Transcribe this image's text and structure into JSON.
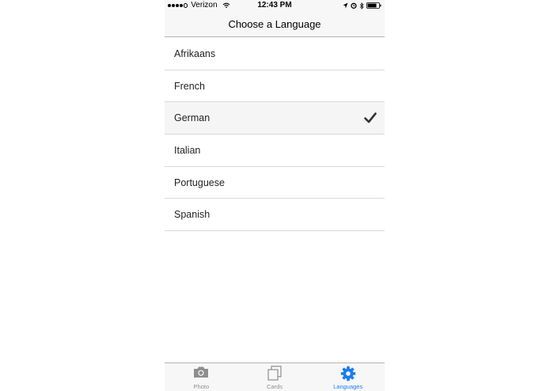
{
  "status_bar": {
    "carrier": "Verizon",
    "time": "12:43 PM"
  },
  "nav": {
    "title": "Choose a Language"
  },
  "languages": [
    {
      "label": "Afrikaans",
      "selected": false
    },
    {
      "label": "French",
      "selected": false
    },
    {
      "label": "German",
      "selected": true
    },
    {
      "label": "Italian",
      "selected": false
    },
    {
      "label": "Portuguese",
      "selected": false
    },
    {
      "label": "Spanish",
      "selected": false
    }
  ],
  "tabs": [
    {
      "label": "Photo",
      "icon": "camera-icon",
      "active": false
    },
    {
      "label": "Cards",
      "icon": "cards-icon",
      "active": false
    },
    {
      "label": "Languages",
      "icon": "gear-icon",
      "active": true
    }
  ],
  "colors": {
    "accent": "#1a7cf2",
    "inactive_tab": "#8e8e8e",
    "selected_row": "#f5f5f5"
  }
}
